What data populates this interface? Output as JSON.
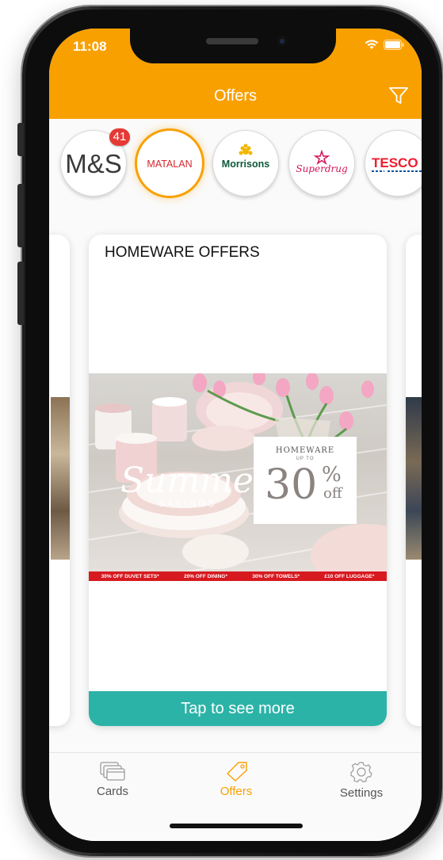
{
  "status": {
    "time": "11:08"
  },
  "header": {
    "title": "Offers"
  },
  "stores": {
    "badge_count": "41",
    "items": [
      {
        "label": "M&S"
      },
      {
        "label": "MATALAN"
      },
      {
        "label": "Morrisons"
      },
      {
        "label": "Superdrug"
      },
      {
        "label": "TESCO"
      }
    ]
  },
  "offer_card": {
    "title": "HOMEWARE OFFERS",
    "banner": {
      "script_text": "Summer",
      "subtitle": "SAVINGS",
      "promo_label": "HOMEWARE",
      "promo_upto": "UP TO",
      "promo_value": "30",
      "promo_percent": "%",
      "promo_off": "off",
      "strip": [
        "30% OFF DUVET SETS*",
        "20% OFF DINING*",
        "30% OFF TOWELS*",
        "£10 OFF LUGGAGE*"
      ]
    },
    "cta": "Tap to see more"
  },
  "tabs": [
    {
      "label": "Cards"
    },
    {
      "label": "Offers"
    },
    {
      "label": "Settings"
    }
  ],
  "colors": {
    "accent": "#f9a001",
    "cta": "#2cb3a7",
    "badge": "#e53935",
    "strip": "#d71920"
  }
}
